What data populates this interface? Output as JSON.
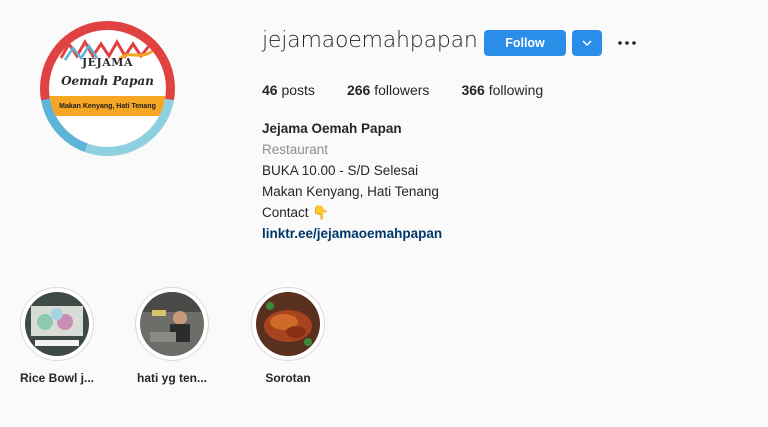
{
  "profile": {
    "username": "jejamaoemahpapan",
    "follow_label": "Follow",
    "avatar": {
      "logo_top": "JEJAMA",
      "logo_mid": "Oemah Papan",
      "tagline": "Makan Kenyang, Hati Tenang"
    }
  },
  "stats": {
    "posts_count": "46",
    "posts_label": "posts",
    "followers_count": "266",
    "followers_label": "followers",
    "following_count": "366",
    "following_label": "following"
  },
  "bio": {
    "name": "Jejama Oemah Papan",
    "category": "Restaurant",
    "line1": "BUKA 10.00 - S/D Selesai",
    "line2": "Makan Kenyang, Hati Tenang",
    "line3": "Contact 👇",
    "link": "linktr.ee/jejamaoemahpapan"
  },
  "highlights": [
    {
      "label": "Rice Bowl j..."
    },
    {
      "label": "hati yg ten..."
    },
    {
      "label": "Sorotan"
    }
  ],
  "colors": {
    "accent": "#2a8de8",
    "link": "#00376b",
    "muted": "#8e8e8e",
    "background": "#fafafa"
  },
  "icons": [
    "chevron-down-icon",
    "more-options-icon"
  ]
}
